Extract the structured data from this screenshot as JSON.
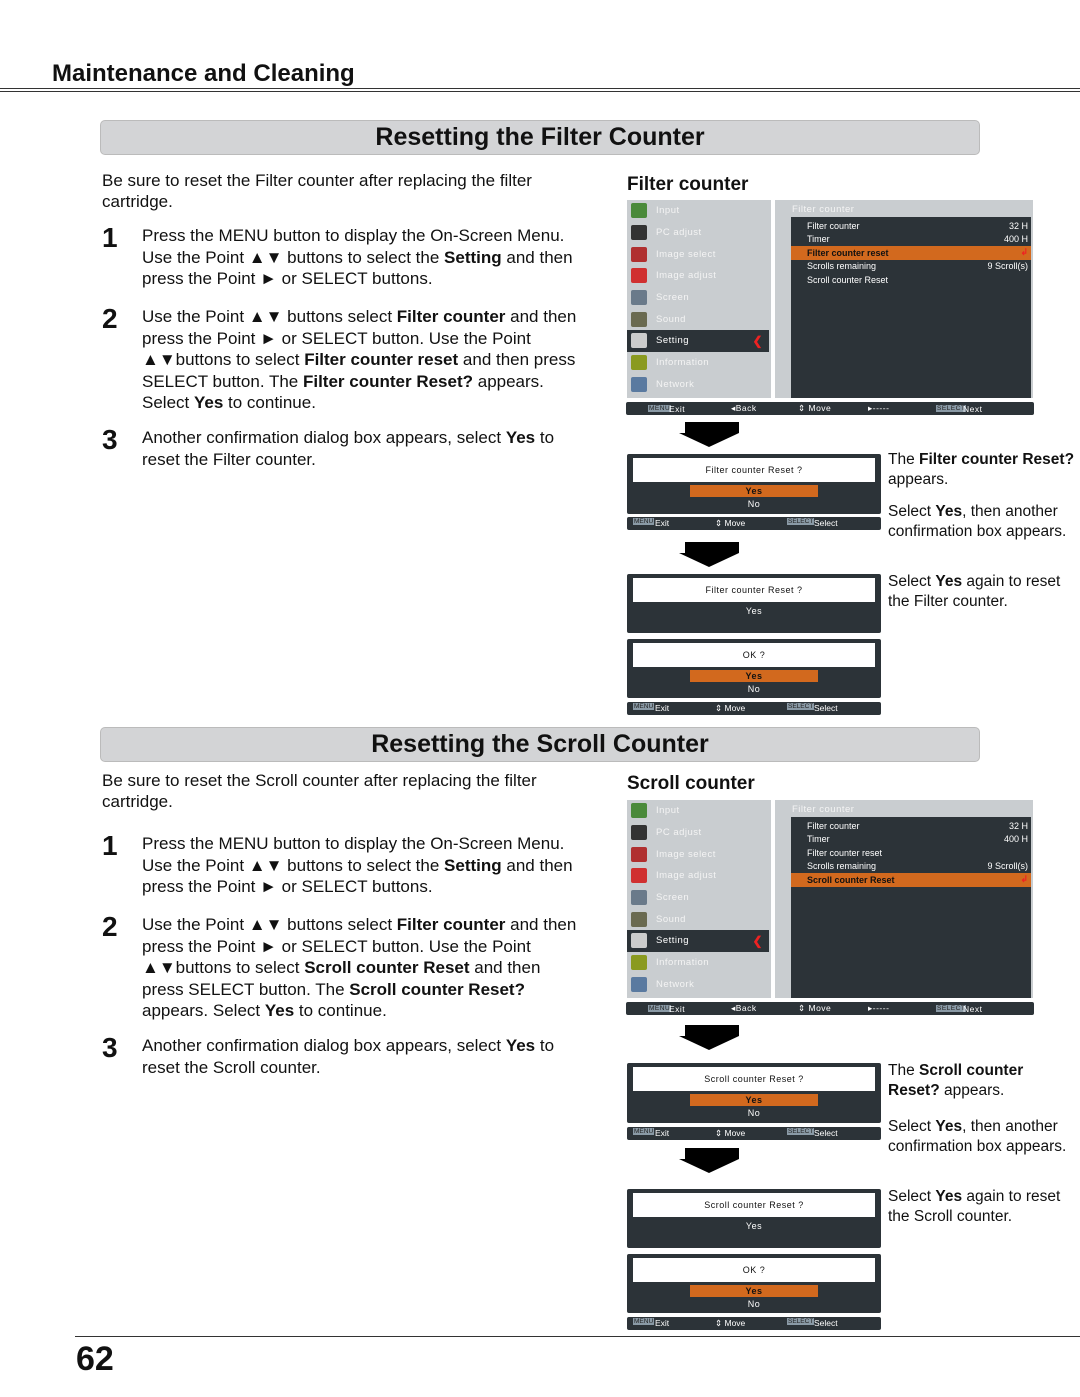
{
  "header": {
    "title": "Maintenance and Cleaning"
  },
  "page_number": "62",
  "colors": {
    "highlight": "#d2691e",
    "panel": "#c9cdd0",
    "dark": "#2c3338",
    "section_bar": "#d3d4d6"
  },
  "sections": [
    {
      "title": "Resetting the Filter Counter",
      "intro": "Be sure to reset the Filter counter after replacing the filter cartridge.",
      "steps": [
        {
          "num": "1",
          "segs": [
            {
              "t": "Press the MENU button to display the On-Screen Menu. Use the Point ▲▼ buttons to select the "
            },
            {
              "t": "Setting",
              "b": true
            },
            {
              "t": " and then press the Point ► or SELECT buttons."
            }
          ]
        },
        {
          "num": "2",
          "segs": [
            {
              "t": "Use the Point ▲▼ buttons select "
            },
            {
              "t": "Filter counter",
              "b": true
            },
            {
              "t": " and then press the Point ► or SELECT button. Use the Point ▲▼buttons to select "
            },
            {
              "t": "Filter counter reset",
              "b": true
            },
            {
              "t": " and then press SELECT button. The "
            },
            {
              "t": "Filter counter Reset?",
              "b": true
            },
            {
              "t": " appears. Select "
            },
            {
              "t": "Yes",
              "b": true
            },
            {
              "t": " to continue."
            }
          ]
        },
        {
          "num": "3",
          "segs": [
            {
              "t": "Another confirmation dialog box appears, select "
            },
            {
              "t": "Yes",
              "b": true
            },
            {
              "t": " to reset the Filter counter."
            }
          ]
        }
      ],
      "subtitle": "Filter counter",
      "menu": {
        "panel_title": "Filter counter",
        "rows": [
          {
            "label": "Filter counter",
            "value": "32 H"
          },
          {
            "label": "Timer",
            "value": "400 H"
          },
          {
            "label": "Filter counter reset",
            "value": "↲",
            "hl": true
          },
          {
            "label": "Scrolls remaining",
            "value": "9 Scroll(s)"
          },
          {
            "label": "Scroll counter Reset",
            "value": ""
          }
        ]
      },
      "dialog1": {
        "question": "Filter counter  Reset ?",
        "yes": "Yes",
        "no": "No"
      },
      "dialog2": {
        "question": "Filter counter  Reset ?",
        "yes": "Yes"
      },
      "dialog3": {
        "question": "OK ?",
        "yes": "Yes",
        "no": "No"
      },
      "captions": [
        [
          {
            "t": "The "
          },
          {
            "t": "Filter counter Reset?",
            "b": true
          },
          {
            "t": " appears."
          }
        ],
        [
          {
            "t": "Select "
          },
          {
            "t": "Yes",
            "b": true
          },
          {
            "t": ", then another confirmation box appears."
          }
        ],
        [
          {
            "t": "Select "
          },
          {
            "t": "Yes",
            "b": true
          },
          {
            "t": " again to reset the Filter counter."
          }
        ]
      ]
    },
    {
      "title": "Resetting the Scroll Counter",
      "intro": "Be sure to reset the Scroll counter after replacing the filter cartridge.",
      "steps": [
        {
          "num": "1",
          "segs": [
            {
              "t": "Press the MENU button to display the On-Screen Menu. Use the Point ▲▼ buttons to select the "
            },
            {
              "t": "Setting",
              "b": true
            },
            {
              "t": " and then press the Point ► or SELECT buttons."
            }
          ]
        },
        {
          "num": "2",
          "segs": [
            {
              "t": "Use the Point ▲▼ buttons select "
            },
            {
              "t": "Filter counter",
              "b": true
            },
            {
              "t": " and then press the Point ► or SELECT button. Use the Point ▲▼buttons to select "
            },
            {
              "t": "Scroll counter Reset",
              "b": true
            },
            {
              "t": " and then press SELECT button. The "
            },
            {
              "t": "Scroll counter Reset?",
              "b": true
            },
            {
              "t": " appears. Select "
            },
            {
              "t": "Yes",
              "b": true
            },
            {
              "t": " to continue."
            }
          ]
        },
        {
          "num": "3",
          "segs": [
            {
              "t": "Another confirmation dialog box appears, select "
            },
            {
              "t": "Yes",
              "b": true
            },
            {
              "t": " to reset the Scroll counter."
            }
          ]
        }
      ],
      "subtitle": "Scroll counter",
      "menu": {
        "panel_title": "Filter counter",
        "rows": [
          {
            "label": "Filter counter",
            "value": "32 H"
          },
          {
            "label": "Timer",
            "value": "400 H"
          },
          {
            "label": "Filter counter reset",
            "value": ""
          },
          {
            "label": "Scrolls remaining",
            "value": "9 Scroll(s)"
          },
          {
            "label": "Scroll counter Reset",
            "value": "↲",
            "hl": true
          }
        ]
      },
      "dialog1": {
        "question": "Scroll counter Reset ?",
        "yes": "Yes",
        "no": "No"
      },
      "dialog2": {
        "question": "Scroll counter Reset ?",
        "yes": "Yes"
      },
      "dialog3": {
        "question": "OK ?",
        "yes": "Yes",
        "no": "No"
      },
      "captions": [
        [
          {
            "t": "The "
          },
          {
            "t": "Scroll counter Reset?",
            "b": true
          },
          {
            "t": " appears."
          }
        ],
        [
          {
            "t": "Select "
          },
          {
            "t": "Yes",
            "b": true
          },
          {
            "t": ", then another confirmation box appears."
          }
        ],
        [
          {
            "t": "Select "
          },
          {
            "t": "Yes",
            "b": true
          },
          {
            "t": " again to reset the Scroll counter."
          }
        ]
      ]
    }
  ],
  "menu_sidebar": [
    {
      "label": "Input",
      "icon": "input-icon",
      "color": "#4a8a3a"
    },
    {
      "label": "PC adjust",
      "icon": "pc-adjust-icon",
      "color": "#333"
    },
    {
      "label": "Image select",
      "icon": "image-select-icon",
      "color": "#b03030"
    },
    {
      "label": "Image adjust",
      "icon": "image-adjust-icon",
      "color": "#d03030"
    },
    {
      "label": "Screen",
      "icon": "screen-icon",
      "color": "#6a7a8a"
    },
    {
      "label": "Sound",
      "icon": "sound-icon",
      "color": "#6a6a50"
    },
    {
      "label": "Setting",
      "icon": "setting-icon",
      "color": "#ccc",
      "selected": true
    },
    {
      "label": "Information",
      "icon": "information-icon",
      "color": "#8a9a20"
    },
    {
      "label": "Network",
      "icon": "network-icon",
      "color": "#5a7aa0"
    }
  ],
  "menu_bar": {
    "exit_key": "MENU",
    "exit": "Exit",
    "back": "◂Back",
    "move": "⇕ Move",
    "next_arrow": "▸-----",
    "next_key": "SELECT",
    "next": "Next"
  },
  "dialog_bar": {
    "exit_key": "MENU",
    "exit": "Exit",
    "move": "⇕ Move",
    "select_key": "SELECT",
    "select": "Select"
  }
}
